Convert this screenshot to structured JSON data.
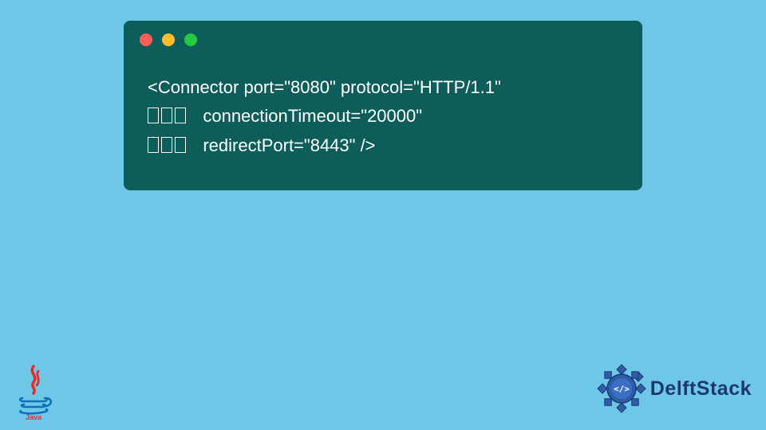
{
  "code": {
    "line1": "<Connector port=\"8080\" protocol=\"HTTP/1.1\"",
    "line2_attr": "connectionTimeout=\"20000\"",
    "line3_attr": "redirectPort=\"8443\" />"
  },
  "branding": {
    "delftstack": "DelftStack",
    "java_label": "Java"
  },
  "colors": {
    "background": "#6fc7e8",
    "code_bg": "#0d5e5a",
    "code_text": "#ffffff",
    "delft_text": "#1a3a6e",
    "java_red": "#e32c2b",
    "java_blue": "#0d6fb8",
    "gear_primary": "#2e5caa",
    "gear_dark": "#1a3a6e"
  }
}
